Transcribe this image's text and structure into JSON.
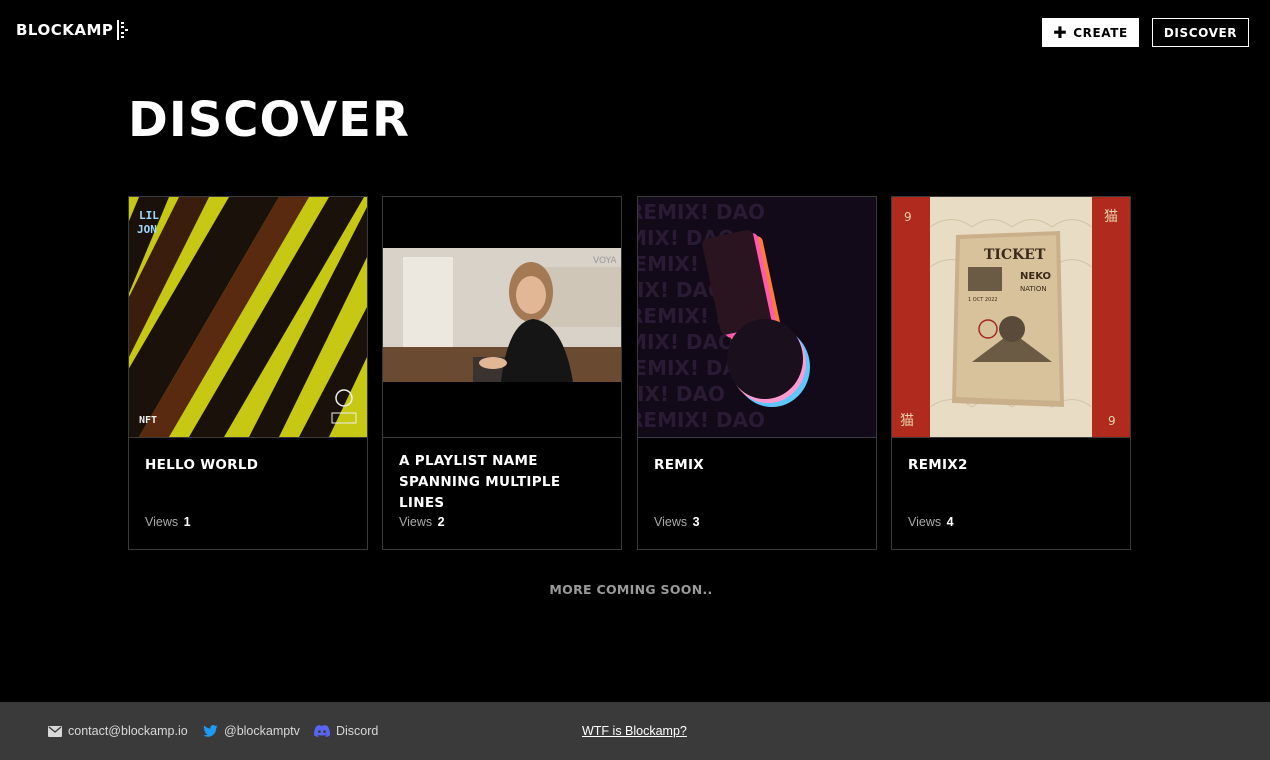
{
  "header": {
    "logo_text": "BLOCKAMP",
    "create_label": "CREATE",
    "discover_label": "DISCOVER"
  },
  "page": {
    "title": "DISCOVER"
  },
  "cards": [
    {
      "title": "HELLO WORLD",
      "views_label": "Views",
      "views": "1",
      "art_text_top": "LIL",
      "art_text_top2": "JON",
      "art_text_bottom": "NFT"
    },
    {
      "title": "A PLAYLIST NAME SPANNING MULTIPLE LINES",
      "views_label": "Views",
      "views": "2",
      "art_text": "VOYA"
    },
    {
      "title": "REMIX",
      "views_label": "Views",
      "views": "3",
      "art_text": "REMIX! DAO"
    },
    {
      "title": "REMIX2",
      "views_label": "Views",
      "views": "4",
      "ticket_title": "TICKET",
      "ticket_brand": "NEKO",
      "ticket_brand2": "NATION",
      "ticket_date": "1 OCT 2022",
      "corner_glyph": "猫"
    }
  ],
  "more_coming": "MORE COMING SOON..",
  "footer": {
    "email": "contact@blockamp.io",
    "twitter": "@blockamptv",
    "discord": "Discord",
    "wtf_link": "WTF is Blockamp?"
  },
  "colors": {
    "background": "#000000",
    "footer_bg": "#3a3a3a",
    "twitter_blue": "#1d9bf0",
    "discord_purple": "#5865f2",
    "art1_yellow": "#c6c814",
    "art4_red": "#b02a1e"
  }
}
